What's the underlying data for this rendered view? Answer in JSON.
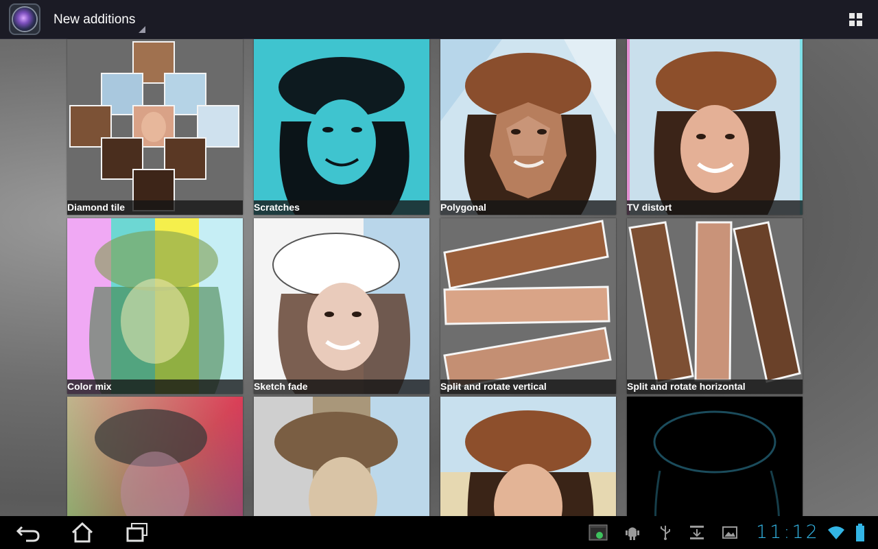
{
  "actionbar": {
    "title": "New additions",
    "app_icon": "camera-lens-icon",
    "view_toggle_icon": "grid-view-icon"
  },
  "effects": [
    {
      "label": "Diamond tile"
    },
    {
      "label": "Scratches"
    },
    {
      "label": "Polygonal"
    },
    {
      "label": "TV distort"
    },
    {
      "label": "Color mix"
    },
    {
      "label": "Sketch fade"
    },
    {
      "label": "Split and rotate vertical"
    },
    {
      "label": "Split and rotate horizontal"
    },
    {
      "label": ""
    },
    {
      "label": ""
    },
    {
      "label": ""
    },
    {
      "label": ""
    }
  ],
  "navbar": {
    "back_icon": "back-icon",
    "home_icon": "home-icon",
    "recents_icon": "recent-apps-icon",
    "status_icons": [
      "screenshot-icon",
      "android-debug-icon",
      "usb-icon",
      "download-icon",
      "gallery-icon"
    ],
    "time": "11:12",
    "wifi_icon": "wifi-icon",
    "battery_icon": "battery-icon"
  },
  "colors": {
    "accent": "#33b5e5",
    "actionbar_bg": "#1b1b25",
    "caption_bg": "#141414"
  }
}
